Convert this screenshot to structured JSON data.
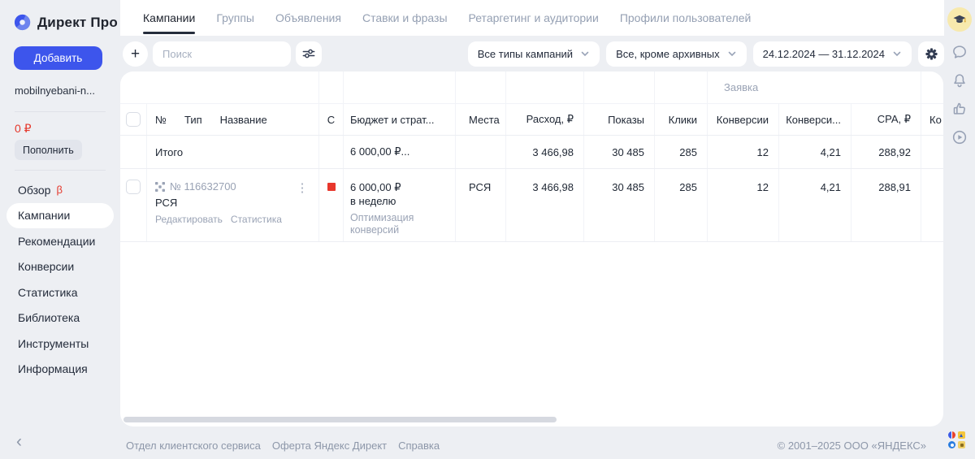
{
  "brand": {
    "name": "Директ Про",
    "add_button": "Добавить",
    "account": "mobilnyebani-n...",
    "balance": "0 ₽",
    "topup": "Пополнить"
  },
  "sidebar": {
    "items": [
      {
        "label": "Обзор",
        "badge": "β"
      },
      {
        "label": "Кампании"
      },
      {
        "label": "Рекомендации"
      },
      {
        "label": "Конверсии"
      },
      {
        "label": "Статистика"
      },
      {
        "label": "Библиотека"
      },
      {
        "label": "Инструменты"
      },
      {
        "label": "Информация"
      }
    ]
  },
  "tabs": [
    "Кампании",
    "Группы",
    "Объявления",
    "Ставки и фразы",
    "Ретаргетинг и аудитории",
    "Профили пользователей"
  ],
  "toolbar": {
    "add_glyph": "+",
    "search_placeholder": "Поиск",
    "filters": [
      "Все типы кампаний",
      "Все, кроме архивных",
      "24.12.2024 — 31.12.2024"
    ]
  },
  "table": {
    "headers": {
      "group": "Заявка",
      "num": "№",
      "type": "Тип",
      "name": "Название",
      "status": "С",
      "budget": "Бюджет и страт...",
      "places": "Места",
      "spend": "Расход, ₽",
      "impressions": "Показы",
      "clicks": "Клики",
      "conversions": "Конверсии",
      "conv_rate": "Конверси...",
      "cpa": "CPA, ₽",
      "last": "Ко"
    },
    "totals": {
      "label": "Итого",
      "budget": "6 000,00 ₽...",
      "spend": "3 466,98",
      "impressions": "30 485",
      "clicks": "285",
      "conversions": "12",
      "conv_rate": "4,21",
      "cpa": "288,92"
    },
    "row": {
      "number": "№ 116632700",
      "name": "РСЯ",
      "edit_link": "Редактировать",
      "stats_link": "Статистика",
      "kebab_glyph": "⋮",
      "budget": "6 000,00 ₽",
      "budget_period": "в неделю",
      "strategy": "Оптимизация конверсий",
      "places": "РСЯ",
      "spend": "3 466,98",
      "impressions": "30 485",
      "clicks": "285",
      "conversions": "12",
      "conv_rate": "4,21",
      "cpa": "288,91"
    }
  },
  "footer": {
    "back_glyph": "‹",
    "links": [
      "Отдел клиентского сервиса",
      "Оферта Яндекс Директ",
      "Справка"
    ],
    "copyright": "© 2001–2025 ООО «ЯНДЕКС»"
  },
  "colors": {
    "accent_blue": "#3d55ec",
    "alert_red": "#e5372b",
    "page_bg": "#edeff3"
  }
}
